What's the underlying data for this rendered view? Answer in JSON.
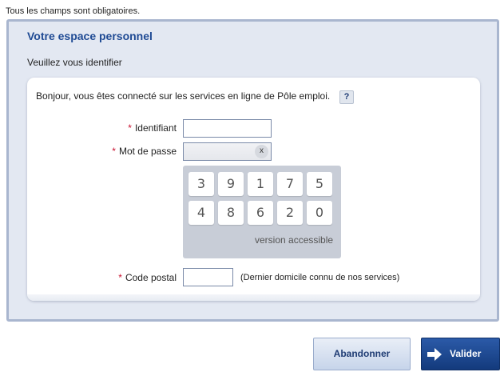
{
  "required_note": "Tous les champs sont obligatoires.",
  "panel": {
    "title": "Votre espace personnel",
    "subtitle": "Veuillez vous identifier"
  },
  "card": {
    "intro": "Bonjour, vous êtes connecté sur les services en ligne de Pôle emploi.",
    "help_label": "?"
  },
  "form": {
    "required_marker": "*",
    "identifiant_label": "Identifiant",
    "identifiant_value": "",
    "password_label": "Mot de passe",
    "clear_label": "x",
    "keypad_row1": [
      "3",
      "9",
      "1",
      "7",
      "5"
    ],
    "keypad_row2": [
      "4",
      "8",
      "6",
      "2",
      "0"
    ],
    "accessible_label": "version accessible",
    "postal_label": "Code postal",
    "postal_value": "",
    "postal_hint": "(Dernier domicile connu de nos services)"
  },
  "buttons": {
    "abandon": "Abandonner",
    "validate": "Valider"
  },
  "colors": {
    "title_blue": "#1f4a94",
    "required_red": "#c8102e",
    "validate_bg": "#1d4a94"
  },
  "icons": {
    "help": "question-mark-icon",
    "clear": "close-icon",
    "validate": "arrow-right-icon"
  }
}
